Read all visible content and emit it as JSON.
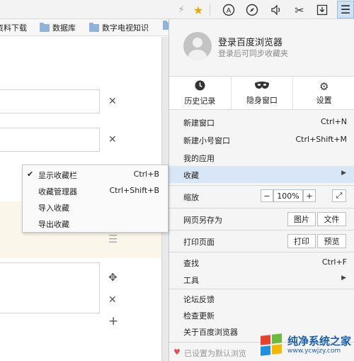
{
  "toolbar": {
    "icons": [
      "lightning-icon",
      "star-icon",
      "a-circle-icon",
      "compass-icon",
      "speaker-icon",
      "scissors-icon",
      "download-icon",
      "menu-icon"
    ]
  },
  "bookmarks": [
    {
      "label": "资料下载"
    },
    {
      "label": "数据库"
    },
    {
      "label": "数字电视知识"
    }
  ],
  "menu": {
    "login_title": "登录百度浏览器",
    "login_sub": "登录后可同步收藏夹",
    "quick": [
      {
        "label": "历史记录",
        "icon": "clock-icon"
      },
      {
        "label": "隐身窗口",
        "icon": "mask-icon"
      },
      {
        "label": "设置",
        "icon": "gear-icon"
      }
    ],
    "new_window": {
      "label": "新建窗口",
      "shortcut": "Ctrl+N"
    },
    "new_small_window": {
      "label": "新建小号窗口",
      "shortcut": "Ctrl+Shift+M"
    },
    "my_apps": {
      "label": "我的应用"
    },
    "favorites": {
      "label": "收藏"
    },
    "zoom": {
      "label": "缩放",
      "minus": "−",
      "value": "100%",
      "plus": "+"
    },
    "save_page": {
      "label": "网页另存为",
      "btn1": "图片",
      "btn2": "文件"
    },
    "print_page": {
      "label": "打印页面",
      "btn1": "打印",
      "btn2": "预览"
    },
    "find": {
      "label": "查找",
      "shortcut": "Ctrl+F"
    },
    "tools": {
      "label": "工具"
    },
    "feedback": {
      "label": "论坛反馈"
    },
    "check_update": {
      "label": "检查更新"
    },
    "about": {
      "label": "关于百度浏览器"
    },
    "default_browser": {
      "label": "已设置为默认浏览"
    }
  },
  "submenu": [
    {
      "label": "显示收藏栏",
      "shortcut": "Ctrl+B",
      "checked": true
    },
    {
      "label": "收藏管理器",
      "shortcut": "Ctrl+Shift+B",
      "checked": false
    },
    {
      "label": "导入收藏",
      "shortcut": "",
      "checked": false
    },
    {
      "label": "导出收藏",
      "shortcut": "",
      "checked": false
    }
  ],
  "watermark": {
    "title": "纯净系统之家",
    "url": "www.ycwjzy.com"
  },
  "colors": {
    "highlight": "#d9e6f6",
    "menu_bg": "#f5f5f5",
    "band": "#fbf6ea"
  }
}
